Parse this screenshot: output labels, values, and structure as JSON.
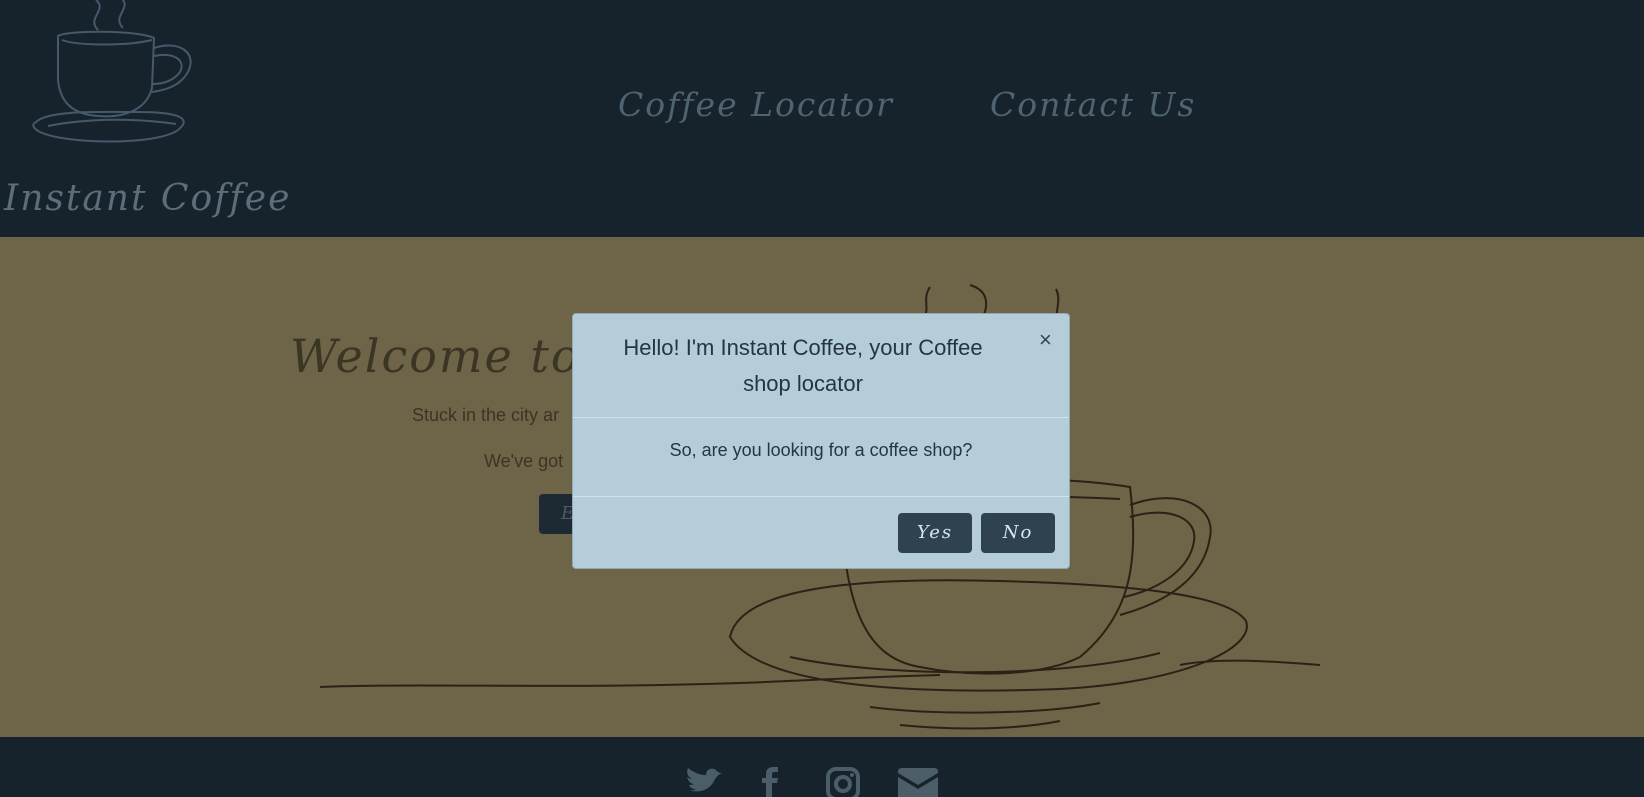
{
  "header": {
    "brand": "Instant Coffee",
    "logo_icon": "coffee-cup-icon",
    "nav": [
      {
        "label": "Coffee Locator"
      },
      {
        "label": "Contact Us"
      }
    ]
  },
  "hero": {
    "title": "Welcome to In",
    "line1": "Stuck in the city ar",
    "line2": "We've got",
    "button_label": "E"
  },
  "modal": {
    "title": "Hello! I'm Instant Coffee, your Coffee shop locator",
    "close_label": "×",
    "question": "So, are you looking for a coffee shop?",
    "yes_label": "Yes",
    "no_label": "No"
  },
  "footer": {
    "social_icons": [
      "twitter-icon",
      "facebook-icon",
      "instagram-icon",
      "email-icon"
    ]
  },
  "colors": {
    "header_bg": "#16232d",
    "hero_bg": "#6e6447",
    "modal_bg": "#b5cdd9",
    "button_bg": "#2e434f"
  }
}
